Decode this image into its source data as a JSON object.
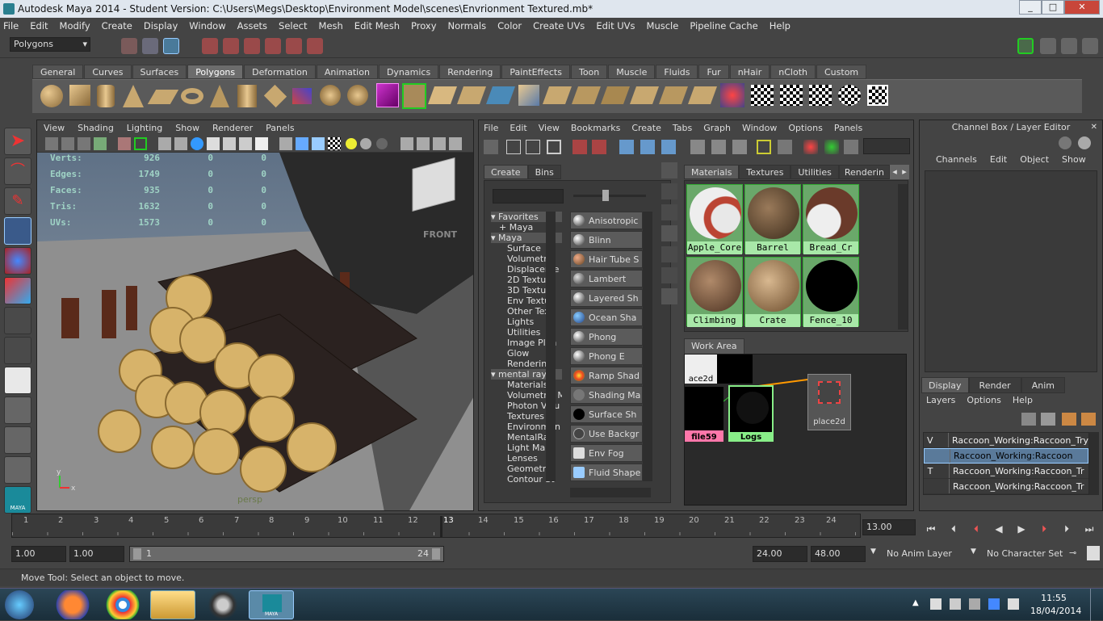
{
  "window": {
    "title": "Autodesk Maya 2014 - Student Version: C:\\Users\\Megs\\Desktop\\Environment Model\\scenes\\Envrionment Textured.mb*",
    "min": "_",
    "max": "□",
    "close": "✕"
  },
  "menubar": [
    "File",
    "Edit",
    "Modify",
    "Create",
    "Display",
    "Window",
    "Assets",
    "Select",
    "Mesh",
    "Edit Mesh",
    "Proxy",
    "Normals",
    "Color",
    "Create UVs",
    "Edit UVs",
    "Muscle",
    "Pipeline Cache",
    "Help"
  ],
  "status": {
    "menu_set": "Polygons"
  },
  "shelf_tabs": [
    "General",
    "Curves",
    "Surfaces",
    "Polygons",
    "Deformation",
    "Animation",
    "Dynamics",
    "Rendering",
    "PaintEffects",
    "Toon",
    "Muscle",
    "Fluids",
    "Fur",
    "nHair",
    "nCloth",
    "Custom"
  ],
  "viewport": {
    "menu": [
      "View",
      "Shading",
      "Lighting",
      "Show",
      "Renderer",
      "Panels"
    ],
    "hud": [
      {
        "label": "Verts:",
        "a": "926",
        "b": "0",
        "c": "0"
      },
      {
        "label": "Edges:",
        "a": "1749",
        "b": "0",
        "c": "0"
      },
      {
        "label": "Faces:",
        "a": "935",
        "b": "0",
        "c": "0"
      },
      {
        "label": "Tris:",
        "a": "1632",
        "b": "0",
        "c": "0"
      },
      {
        "label": "UVs:",
        "a": "1573",
        "b": "0",
        "c": "0"
      }
    ],
    "cube_label": "FRONT",
    "camera": "persp",
    "axis_y": "y",
    "axis_x": "x"
  },
  "hypershade": {
    "menu": [
      "File",
      "Edit",
      "View",
      "Bookmarks",
      "Create",
      "Tabs",
      "Graph",
      "Window",
      "Options",
      "Panels"
    ],
    "create_tabs": [
      "Create",
      "Bins"
    ],
    "tree": [
      "Favorites",
      "+ Maya",
      "Maya",
      "Surface",
      "Volumetric",
      "Displaceme",
      "2D Texture",
      "3D Texture",
      "Env Textur",
      "Other Text",
      "Lights",
      "Utilities",
      "Image Plan",
      "Glow",
      "Rendering",
      "mental ray",
      "Materials",
      "Volumetric M",
      "Photon Volu",
      "Textures",
      "Environmen",
      "MentalRay",
      "Light Maps",
      "Lenses",
      "Geometry",
      "Contour St"
    ],
    "shaders": [
      "Anisotropic",
      "Blinn",
      "Hair Tube S",
      "Lambert",
      "Layered Sh",
      "Ocean Sha",
      "Phong",
      "Phong E",
      "Ramp Shad",
      "Shading Ma",
      "Surface Sh",
      "Use Backgr",
      "Env Fog",
      "Fluid Shape"
    ],
    "tabs": [
      "Materials",
      "Textures",
      "Utilities",
      "Renderin"
    ],
    "materials": [
      "Apple_Core",
      "Barrel",
      "Bread_Cr",
      "Climbing",
      "Crate",
      "Fence_10"
    ],
    "work_area_tab": "Work Area",
    "nodes": [
      "ace2d",
      "file59",
      "Logs",
      "place2d"
    ]
  },
  "channelbox": {
    "title": "Channel Box / Layer Editor",
    "menu": [
      "Channels",
      "Edit",
      "Object",
      "Show"
    ],
    "layer_tabs": [
      "Display",
      "Render",
      "Anim"
    ],
    "layer_menu": [
      "Layers",
      "Options",
      "Help"
    ],
    "layers": [
      {
        "v": "V",
        "name": "Raccoon_Working:Raccoon_Try"
      },
      {
        "v": "",
        "name": "Raccoon_Working:Raccoon"
      },
      {
        "v": "T",
        "name": "Raccoon_Working:Raccoon_Tr"
      },
      {
        "v": "",
        "name": "Raccoon_Working:Raccoon_Tr"
      }
    ]
  },
  "timeline": {
    "ticks": [
      "1",
      "2",
      "3",
      "4",
      "5",
      "6",
      "7",
      "8",
      "9",
      "10",
      "11",
      "12",
      "13",
      "14",
      "15",
      "16",
      "17",
      "18",
      "19",
      "20",
      "21",
      "22",
      "23",
      "24"
    ],
    "current": "13.00"
  },
  "range": {
    "start": "1.00",
    "start2": "1.00",
    "slider_start": "1",
    "slider_end": "24",
    "end": "24.00",
    "end2": "48.00",
    "anim_layer": "No Anim Layer",
    "character_set": "No Character Set"
  },
  "helpline": "Move Tool: Select an object to move.",
  "taskbar": {
    "time": "11:55",
    "date": "18/04/2014",
    "maya_label": "MAYA"
  }
}
